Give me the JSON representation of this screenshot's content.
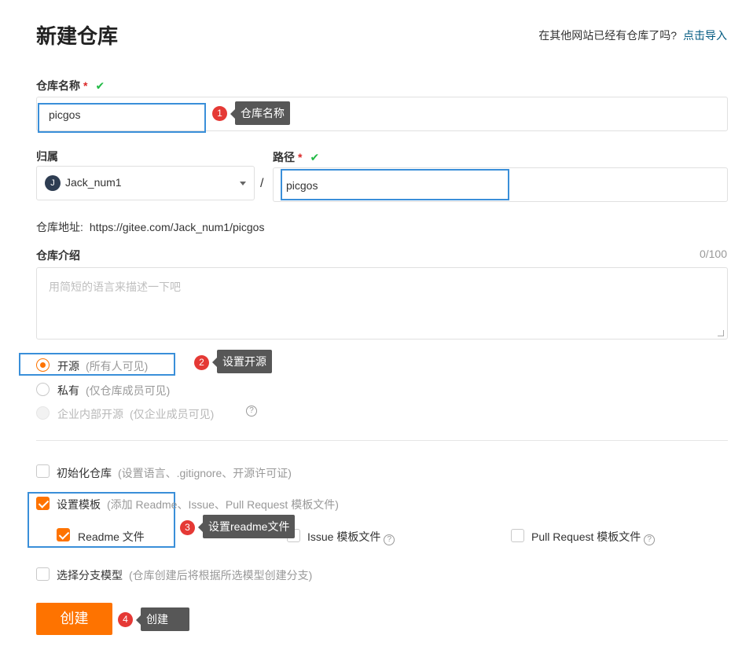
{
  "title": "新建仓库",
  "import": {
    "question": "在其他网站已经有仓库了吗?",
    "link": "点击导入"
  },
  "repo_name": {
    "label": "仓库名称",
    "required": "*",
    "check": "✔",
    "value": "picgos"
  },
  "owner": {
    "label": "归属",
    "avatar_letter": "J",
    "value": "Jack_num1",
    "separator": "/"
  },
  "path": {
    "label": "路径",
    "required": "*",
    "check": "✔",
    "value": "picgos"
  },
  "repo_url": {
    "label": "仓库地址:",
    "value": "https://gitee.com/Jack_num1/picgos"
  },
  "intro": {
    "label": "仓库介绍",
    "counter": "0/100",
    "placeholder": "用简短的语言来描述一下吧"
  },
  "visibility": [
    {
      "label": "开源",
      "sub": "(所有人可见)",
      "selected": true
    },
    {
      "label": "私有",
      "sub": "(仅仓库成员可见)",
      "selected": false
    },
    {
      "label": "企业内部开源",
      "sub": "(仅企业成员可见)",
      "selected": false,
      "disabled": true
    }
  ],
  "init_repo": {
    "label": "初始化仓库",
    "sub": "(设置语言、.gitignore、开源许可证)",
    "checked": false
  },
  "template": {
    "label": "设置模板",
    "sub": "(添加 Readme、Issue、Pull Request 模板文件)",
    "checked": true
  },
  "template_files": [
    {
      "label": "Readme 文件",
      "checked": true
    },
    {
      "label": "Issue 模板文件",
      "checked": false
    },
    {
      "label": "Pull Request 模板文件",
      "checked": false
    }
  ],
  "branch_model": {
    "label": "选择分支模型",
    "sub": "(仓库创建后将根据所选模型创建分支)",
    "checked": false
  },
  "create_button": "创建",
  "annotations": [
    {
      "number": "1",
      "text": "仓库名称"
    },
    {
      "number": "2",
      "text": "设置开源"
    },
    {
      "number": "3",
      "text": "设置readme文件"
    },
    {
      "number": "4",
      "text": "创建"
    }
  ],
  "colors": {
    "accent": "#fe7300",
    "highlight": "#3a8fd9",
    "badge": "#e53935",
    "tooltip": "#575757",
    "check": "#21ba45"
  }
}
